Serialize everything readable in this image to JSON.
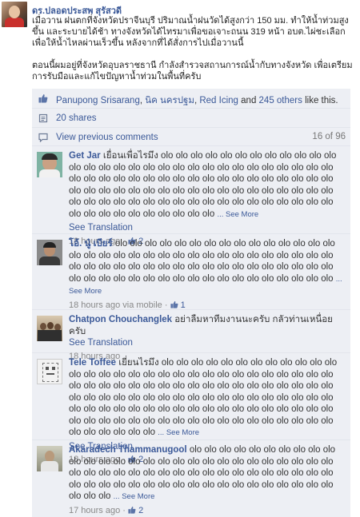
{
  "post": {
    "author": "ดร.ปลอดประสพ สุรัสวดี",
    "paragraph1": "เมื่อวาน ฝนตกที่จังหวัดปราจีนบุรี ปริมาณน้ำฝนวัดได้สูงกว่า 150 มม. ทำให้น้ำท่วมสูงขึ้น และระบายได้ช้า ทางจังหวัดได้ไทรมาเพื่อขอเจาะถนน 319 หน้า อบต.ไผ่ชะเลือก เพื่อให้น้ำไหลผ่านเร็วขึ้น หลังจากที่ได้สั่งการไปเมื่อวานนี้",
    "paragraph2": "ตอนนี้ผมอยู่ที่จังหวัดอุบลราชธานี กำลังสำรวจสถานการณ์น้ำกับทางจังหวัด เพื่อเตรียมการรับมือและแก้ไขปัญหาน้ำท่วมในพื้นที่ครับ"
  },
  "ufi": {
    "likers": [
      "Panupong Srisarang",
      "นิค นครปฐม",
      "Red Icing"
    ],
    "likes_sep1": ", ",
    "likes_sep2": ", ",
    "likes_and": " and ",
    "likes_others": "245 others",
    "likes_tail": " like this.",
    "shares": "20 shares",
    "view_previous": "View previous comments",
    "previous_count": "16 of 96"
  },
  "comments": [
    {
      "name": "Get Jar",
      "text": "เยื่อนเพื่อไรมึง olo olo olo olo olo olo olo olo olo olo olo olo olo olo olo olo olo olo olo olo olo olo olo olo olo olo olo olo olo olo olo olo olo olo olo olo olo olo olo olo olo olo olo olo olo olo olo olo olo olo olo olo olo olo olo olo olo olo olo olo olo olo olo olo olo olo olo olo olo olo olo olo olo olo olo olo olo olo olo olo olo olo olo olo olo olo olo olo olo olo olo olo olo olo",
      "see_more": "... See More",
      "see_translation": "See Translation",
      "time": "18 hours ago",
      "likes": "2"
    },
    {
      "name": "โอ้. นู๋ เบียร์",
      "text": "olo olo olo olo olo olo olo olo olo olo olo olo olo olo olo olo olo olo olo olo olo olo olo olo olo olo olo olo olo olo olo olo olo olo olo olo olo olo olo olo olo olo olo olo olo olo olo olo olo olo olo olo olo olo olo olo olo olo olo olo olo olo olo olo olo olo olo olo olo",
      "see_more": "... See More",
      "time": "18 hours ago via mobile",
      "likes": "1"
    },
    {
      "name": "Chatpon Chouchanglek",
      "text": "อย่าลืมหาทีมงานนะครับ กลัวท่านเหนื่อยครับ",
      "see_translation": "See Translation",
      "time": "18 hours ago"
    },
    {
      "name": "Tele Toffee",
      "text": "เยี่ยนไรมึง olo olo olo olo olo olo olo olo olo olo olo olo olo olo olo olo olo olo olo olo olo olo olo olo olo olo olo olo olo olo olo olo olo olo olo olo olo olo olo olo olo olo olo olo olo olo olo olo olo olo olo olo olo olo olo olo olo olo olo olo olo olo olo olo olo olo olo olo olo olo olo olo olo olo olo olo olo olo olo olo olo olo olo olo olo olo olo olo olo olo olo olo olo olo olo olo olo olo olo olo olo olo olo olo olo olo olo olo",
      "see_more": "... See More",
      "see_translation": "See Translation",
      "time": "18 hours ago",
      "likes": "2"
    },
    {
      "name": "Akaradech Thammanugool",
      "text": "olo olo olo olo olo olo olo olo olo olo olo olo olo olo olo olo olo olo olo olo olo olo olo olo olo olo olo olo olo olo olo olo olo olo olo olo olo olo olo olo olo olo olo olo olo olo olo olo olo olo olo olo olo olo olo olo olo olo olo olo olo olo olo olo olo olo olo",
      "see_more": "... See More",
      "time": "17 hours ago",
      "likes": "2"
    }
  ],
  "separators": {
    "dot": " · "
  },
  "colors": {
    "link": "#3b5998",
    "ufi_bg": "#edeff4",
    "meta": "#888888"
  }
}
